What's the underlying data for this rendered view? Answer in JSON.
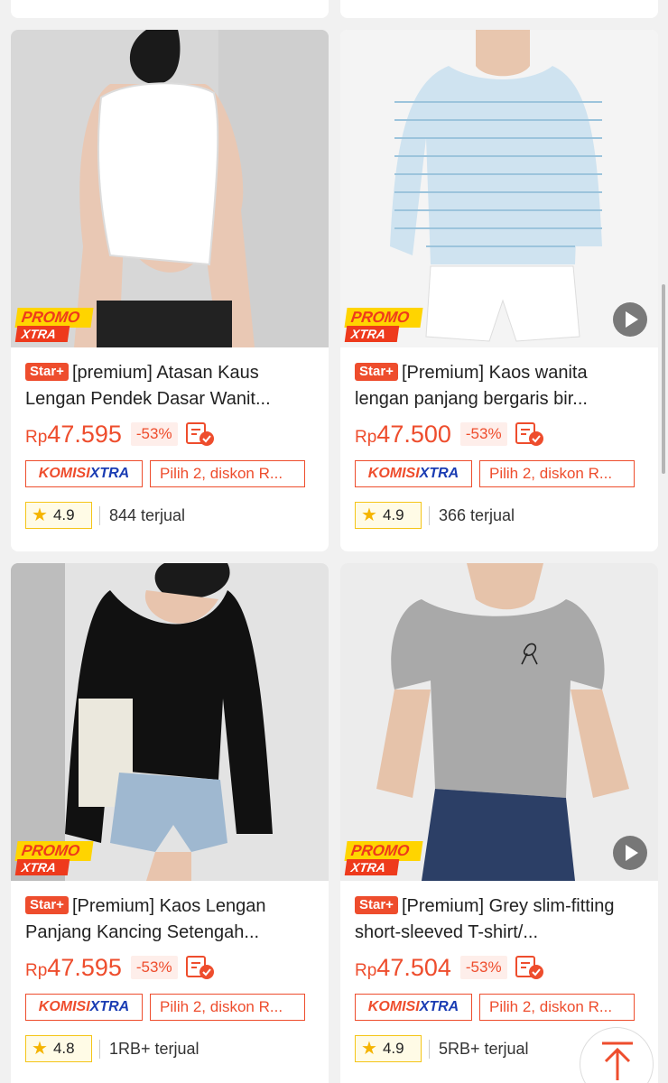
{
  "products": [
    {
      "title": "[premium] Atasan Kaus Lengan Pendek Dasar Wanit...",
      "badge": "Star+",
      "currency": "Rp",
      "price": "47.595",
      "discount": "-53%",
      "komisi_a": "KOMISI",
      "komisi_b": "XTRA",
      "promo_text": "Pilih 2, diskon R...",
      "rating": "4.9",
      "sold": "844 terjual",
      "promo_label_1": "PROMO",
      "promo_label_2": "XTRA",
      "has_video": false,
      "shirt_color": "#ffffff"
    },
    {
      "title": "[Premium] Kaos wanita lengan panjang bergaris bir...",
      "badge": "Star+",
      "currency": "Rp",
      "price": "47.500",
      "discount": "-53%",
      "komisi_a": "KOMISI",
      "komisi_b": "XTRA",
      "promo_text": "Pilih 2, diskon R...",
      "rating": "4.9",
      "sold": "366 terjual",
      "promo_label_1": "PROMO",
      "promo_label_2": "XTRA",
      "has_video": true,
      "shirt_color": "#cfe3f0"
    },
    {
      "title": "[Premium] Kaos Lengan Panjang Kancing Setengah...",
      "badge": "Star+",
      "currency": "Rp",
      "price": "47.595",
      "discount": "-53%",
      "komisi_a": "KOMISI",
      "komisi_b": "XTRA",
      "promo_text": "Pilih 2, diskon R...",
      "rating": "4.8",
      "sold": "1RB+ terjual",
      "promo_label_1": "PROMO",
      "promo_label_2": "XTRA",
      "has_video": false,
      "shirt_color": "#111111"
    },
    {
      "title": "[Premium] Grey slim-fitting short-sleeved T-shirt/...",
      "badge": "Star+",
      "currency": "Rp",
      "price": "47.504",
      "discount": "-53%",
      "komisi_a": "KOMISI",
      "komisi_b": "XTRA",
      "promo_text": "Pilih 2, diskon R...",
      "rating": "4.9",
      "sold": "5RB+ terjual",
      "promo_label_1": "PROMO",
      "promo_label_2": "XTRA",
      "has_video": true,
      "shirt_color": "#a9a9a9"
    }
  ],
  "colors": {
    "accent": "#ee4d2d",
    "promo_yellow": "#ffd400",
    "komisi_blue": "#1a3cb3",
    "star": "#f5b400"
  },
  "icons": {
    "play": "play-icon",
    "cod": "cod-check-icon",
    "star": "star-icon",
    "scroll_top": "arrow-up-icon"
  }
}
